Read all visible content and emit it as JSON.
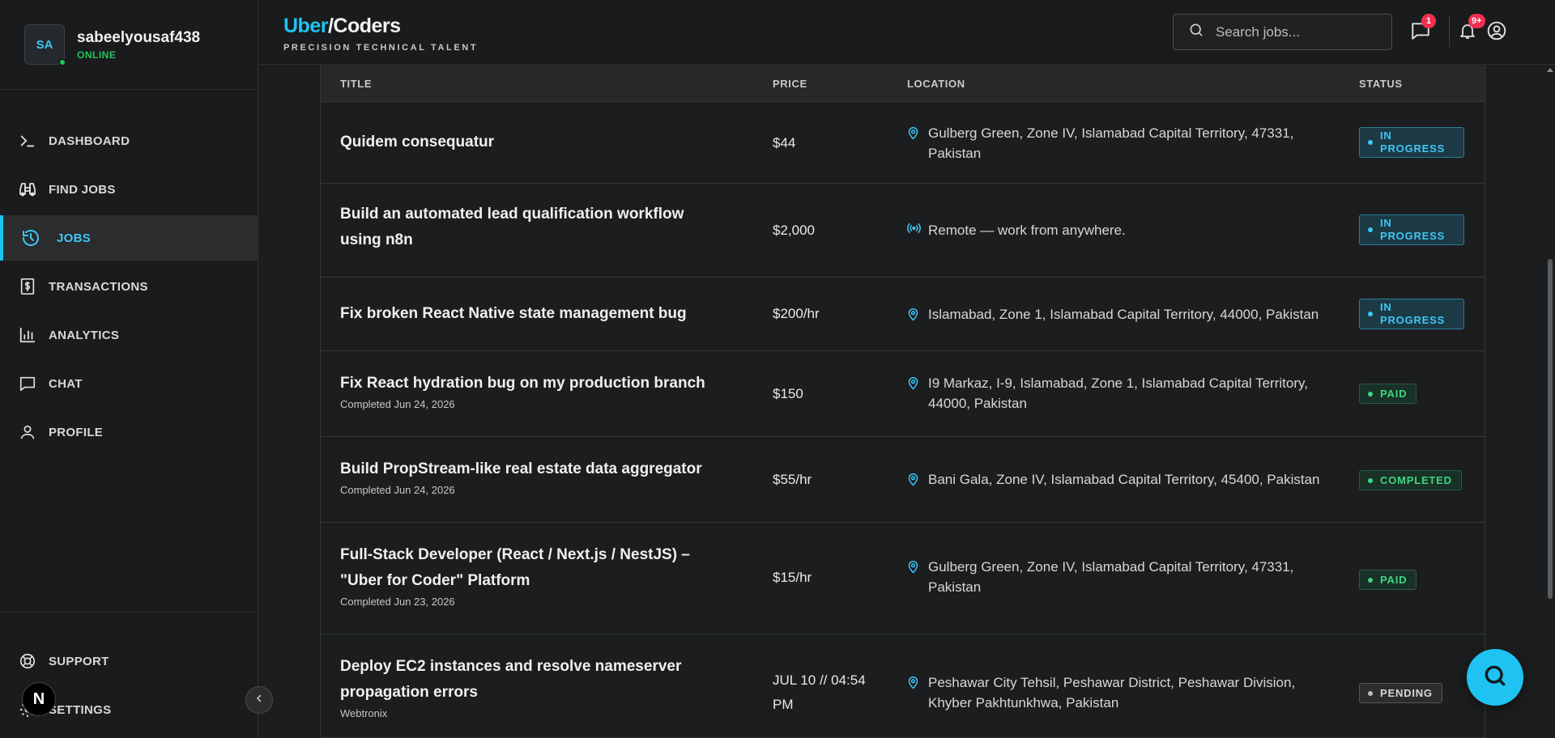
{
  "user": {
    "initials": "SA",
    "name": "sabeelyousaf438",
    "status": "ONLINE"
  },
  "sidebar": {
    "items": [
      {
        "label": "DASHBOARD",
        "icon": "terminal-icon"
      },
      {
        "label": "FIND JOBS",
        "icon": "binoculars-icon"
      },
      {
        "label": "JOBS",
        "icon": "history-icon",
        "active": true
      },
      {
        "label": "TRANSACTIONS",
        "icon": "receipt-dollar-icon"
      },
      {
        "label": "ANALYTICS",
        "icon": "bar-chart-icon"
      },
      {
        "label": "CHAT",
        "icon": "chat-icon"
      },
      {
        "label": "PROFILE",
        "icon": "user-icon"
      }
    ],
    "bottom": [
      {
        "label": "SUPPORT",
        "icon": "lifebuoy-icon"
      },
      {
        "label": "SETTINGS",
        "icon": "gear-icon"
      }
    ],
    "next_badge": "N"
  },
  "header": {
    "brand_accent": "Uber",
    "brand_rest": "/Coders",
    "tagline": "PRECISION TECHNICAL TALENT",
    "search_placeholder": "Search jobs...",
    "chat_count": "1",
    "notification_count": "9+"
  },
  "table": {
    "headers": {
      "title": "TITLE",
      "price": "PRICE",
      "location": "LOCATION",
      "status": "STATUS"
    },
    "rows": [
      {
        "title": "Quidem consequatur",
        "subtitle": "",
        "price": "$44",
        "location": "Gulberg Green, Zone IV, Islamabad Capital Territory, 47331, Pakistan",
        "location_type": "pin",
        "status": "IN PROGRESS"
      },
      {
        "title": "Build an automated lead qualification workflow using n8n",
        "subtitle": "",
        "price": "$2,000",
        "location": "Remote — work from anywhere.",
        "location_type": "remote",
        "status": "IN PROGRESS"
      },
      {
        "title": "Fix broken React Native state management bug",
        "subtitle": "",
        "price": "$200/hr",
        "location": "Islamabad, Zone 1, Islamabad Capital Territory, 44000, Pakistan",
        "location_type": "pin",
        "status": "IN PROGRESS"
      },
      {
        "title": "Fix React hydration bug on my production branch",
        "subtitle": "Completed Jun 24, 2026",
        "price": "$150",
        "location": "I9 Markaz, I-9, Islamabad, Zone 1, Islamabad Capital Territory, 44000, Pakistan",
        "location_type": "pin",
        "status": "PAID"
      },
      {
        "title": "Build PropStream-like real estate data aggregator",
        "subtitle": "Completed Jun 24, 2026",
        "price": "$55/hr",
        "location": "Bani Gala, Zone IV, Islamabad Capital Territory, 45400, Pakistan",
        "location_type": "pin",
        "status": "COMPLETED"
      },
      {
        "title": "Full-Stack Developer (React / Next.js / NestJS) – \"Uber for Coder\" Platform",
        "subtitle": "Completed Jun 23, 2026",
        "price": "$15/hr",
        "location": "Gulberg Green, Zone IV, Islamabad Capital Territory, 47331, Pakistan",
        "location_type": "pin",
        "status": "PAID"
      },
      {
        "title": "Deploy EC2 instances and resolve nameserver propagation errors",
        "subtitle": "Webtronix",
        "price": "JUL 10 // 04:54 PM",
        "location": "Peshawar City Tehsil, Peshawar District, Peshawar Division, Khyber Pakhtunkhwa, Pakistan",
        "location_type": "pin",
        "status": "PENDING"
      }
    ]
  },
  "colors": {
    "accent": "#1ec3f2",
    "online": "#22c55e",
    "badge": "#f0304f",
    "paid": "#3ed77e"
  }
}
